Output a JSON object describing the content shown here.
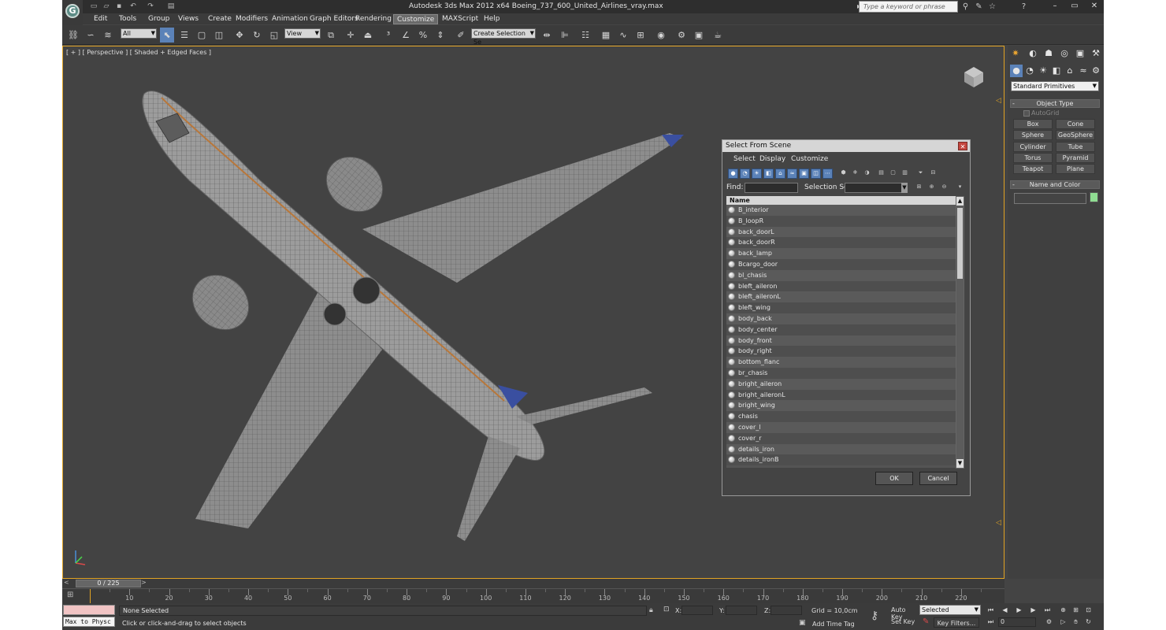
{
  "window": {
    "title": "Autodesk 3ds Max  2012 x64     Boeing_737_600_United_Airlines_vray.max",
    "search_placeholder": "Type a keyword or phrase"
  },
  "menu": [
    "Edit",
    "Tools",
    "Group",
    "Views",
    "Create",
    "Modifiers",
    "Animation",
    "Graph Editors",
    "Rendering",
    "Customize",
    "MAXScript",
    "Help"
  ],
  "toolbar": {
    "filter_value": "All",
    "refcoord_value": "View",
    "named_selection_placeholder": "Create Selection Se"
  },
  "viewport": {
    "label": "[ + ] [ Perspective ] [ Shaded + Edged Faces ]"
  },
  "dialog": {
    "title": "Select From Scene",
    "menus": [
      "Select",
      "Display",
      "Customize"
    ],
    "find_label": "Find:",
    "selection_set_label": "Selection Set:",
    "column_header": "Name",
    "items": [
      "B_interior",
      "B_loopR",
      "back_doorL",
      "back_doorR",
      "back_lamp",
      "Bcargo_door",
      "bl_chasis",
      "bleft_aileron",
      "bleft_aileronL",
      "bleft_wing",
      "body_back",
      "body_center",
      "body_front",
      "body_right",
      "bottom_flanc",
      "br_chasis",
      "bright_aileron",
      "bright_aileronL",
      "bright_wing",
      "chasis",
      "cover_l",
      "cover_r",
      "details_iron",
      "details_ironB"
    ],
    "ok_label": "OK",
    "cancel_label": "Cancel"
  },
  "command_panel": {
    "category": "Standard Primitives",
    "object_type_label": "Object Type",
    "autogrid_label": "AutoGrid",
    "primitives": [
      "Box",
      "Cone",
      "Sphere",
      "GeoSphere",
      "Cylinder",
      "Tube",
      "Torus",
      "Pyramid",
      "Teapot",
      "Plane"
    ],
    "name_color_label": "Name and Color",
    "object_color": "#8fdc92"
  },
  "timeline": {
    "slider_label": "0 / 225",
    "current_frame": 0,
    "total_frames": 225,
    "ticks": [
      10,
      20,
      30,
      40,
      50,
      60,
      70,
      80,
      90,
      100,
      110,
      120,
      130,
      140,
      150,
      160,
      170,
      180,
      190,
      200,
      210,
      220
    ]
  },
  "status": {
    "maxscript": "Max to Physc",
    "selection": "None Selected",
    "prompt": "Click or click-and-drag to select objects",
    "x_label": "X:",
    "y_label": "Y:",
    "z_label": "Z:",
    "grid": "Grid = 10,0cm",
    "add_time_tag": "Add Time Tag",
    "auto_key": "Auto Key",
    "set_key": "Set Key",
    "key_mode": "Selected",
    "key_filters": "Key Filters...",
    "frame_value": "0"
  },
  "colors": {
    "viewport_border": "#e1a323",
    "active_tool": "#5b82b8",
    "model_body": "#9a9a9a",
    "tail_blue": "#3a4fa0"
  }
}
